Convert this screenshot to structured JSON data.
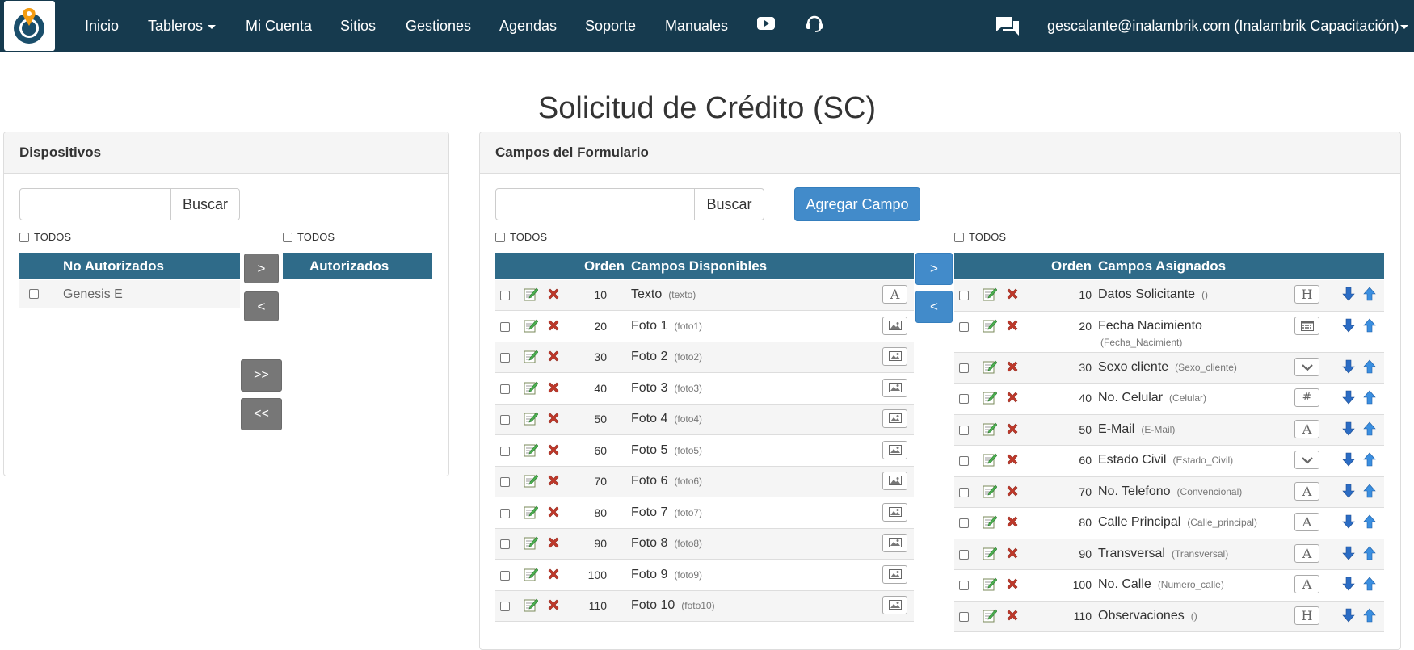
{
  "nav": {
    "items": [
      "Inicio",
      "Tableros",
      "Mi Cuenta",
      "Sitios",
      "Gestiones",
      "Agendas",
      "Soporte",
      "Manuales"
    ],
    "icons": [
      "youtube-icon",
      "headset-icon",
      "chat-icon"
    ],
    "user": "gescalante@inalambrik.com (Inalambrik Capacitación)"
  },
  "page": {
    "title": "Solicitud de Crédito (SC)"
  },
  "devices": {
    "title": "Dispositivos",
    "search_label": "Buscar",
    "todos_left": "TODOS",
    "todos_right": "TODOS",
    "header_left": "No Autorizados",
    "header_right": "Autorizados",
    "rows": [
      "Genesis E"
    ],
    "btn_move_right": ">",
    "btn_move_left": "<",
    "btn_move_all_right": ">>",
    "btn_move_all_left": "<<"
  },
  "fields": {
    "title": "Campos del Formulario",
    "search_label": "Buscar",
    "add_label": "Agregar Campo",
    "todos_left": "TODOS",
    "todos_right": "TODOS",
    "btn_right": ">",
    "btn_left": "<",
    "available_headers": {
      "order": "Orden",
      "name": "Campos Disponibles"
    },
    "assigned_headers": {
      "order": "Orden",
      "name": "Campos Asignados"
    },
    "available": [
      {
        "order": "10",
        "name": "Texto",
        "code": "(texto)",
        "type": "text"
      },
      {
        "order": "20",
        "name": "Foto 1",
        "code": "(foto1)",
        "type": "image"
      },
      {
        "order": "30",
        "name": "Foto 2",
        "code": "(foto2)",
        "type": "image"
      },
      {
        "order": "40",
        "name": "Foto 3",
        "code": "(foto3)",
        "type": "image"
      },
      {
        "order": "50",
        "name": "Foto 4",
        "code": "(foto4)",
        "type": "image"
      },
      {
        "order": "60",
        "name": "Foto 5",
        "code": "(foto5)",
        "type": "image"
      },
      {
        "order": "70",
        "name": "Foto 6",
        "code": "(foto6)",
        "type": "image"
      },
      {
        "order": "80",
        "name": "Foto 7",
        "code": "(foto7)",
        "type": "image"
      },
      {
        "order": "90",
        "name": "Foto 8",
        "code": "(foto8)",
        "type": "image"
      },
      {
        "order": "100",
        "name": "Foto 9",
        "code": "(foto9)",
        "type": "image"
      },
      {
        "order": "110",
        "name": "Foto 10",
        "code": "(foto10)",
        "type": "image"
      }
    ],
    "assigned": [
      {
        "order": "10",
        "name": "Datos Solicitante",
        "code": "()",
        "type": "H"
      },
      {
        "order": "20",
        "name": "Fecha Nacimiento",
        "code": "(Fecha_Nacimient)",
        "type": "calendar"
      },
      {
        "order": "30",
        "name": "Sexo cliente",
        "code": "(Sexo_cliente)",
        "type": "select"
      },
      {
        "order": "40",
        "name": "No. Celular",
        "code": "(Celular)",
        "type": "#"
      },
      {
        "order": "50",
        "name": "E-Mail",
        "code": "(E-Mail)",
        "type": "A"
      },
      {
        "order": "60",
        "name": "Estado Civil",
        "code": "(Estado_Civil)",
        "type": "select"
      },
      {
        "order": "70",
        "name": "No. Telefono",
        "code": "(Convencional)",
        "type": "A"
      },
      {
        "order": "80",
        "name": "Calle Principal",
        "code": "(Calle_principal)",
        "type": "A"
      },
      {
        "order": "90",
        "name": "Transversal",
        "code": "(Transversal)",
        "type": "A"
      },
      {
        "order": "100",
        "name": "No. Calle",
        "code": "(Numero_calle)",
        "type": "A"
      },
      {
        "order": "110",
        "name": "Observaciones",
        "code": "()",
        "type": "H"
      }
    ]
  },
  "colors": {
    "navbar": "#163a4e",
    "table_header": "#2f6b89",
    "primary": "#428bca",
    "delete": "#c0392b"
  }
}
